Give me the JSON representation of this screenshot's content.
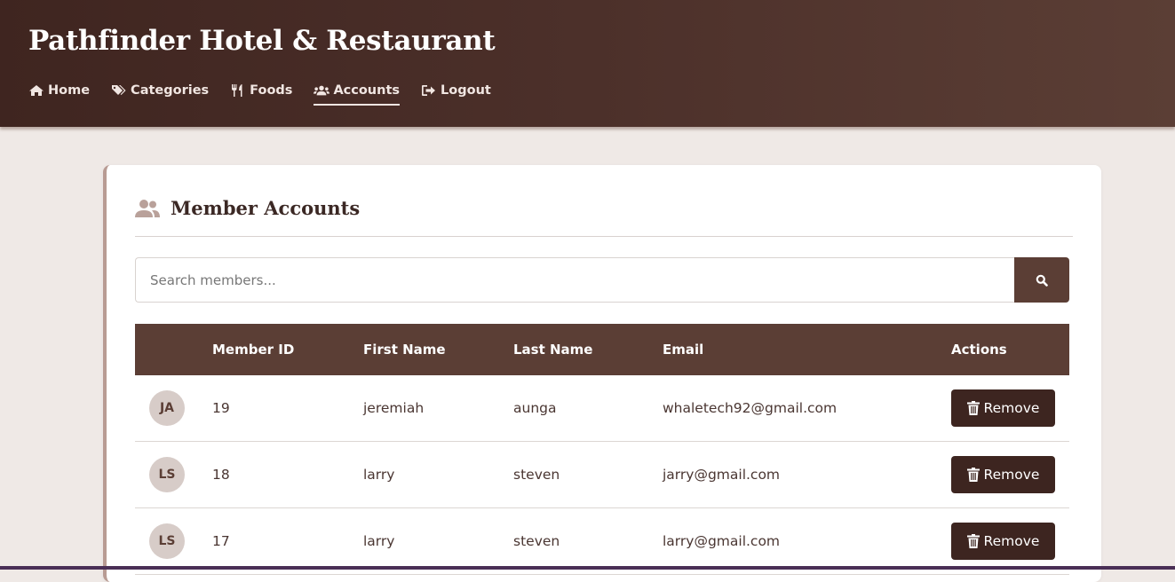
{
  "header": {
    "title": "Pathfinder Hotel & Restaurant",
    "nav": [
      {
        "label": "Home",
        "icon": "home-icon"
      },
      {
        "label": "Categories",
        "icon": "tags-icon"
      },
      {
        "label": "Foods",
        "icon": "utensils-icon"
      },
      {
        "label": "Accounts",
        "icon": "users-icon",
        "active": true
      },
      {
        "label": "Logout",
        "icon": "sign-out-icon"
      }
    ]
  },
  "card": {
    "title": "Member Accounts",
    "icon": "users-icon"
  },
  "search": {
    "placeholder": "Search members...",
    "button_icon": "search-icon"
  },
  "table": {
    "columns": [
      "",
      "Member ID",
      "First Name",
      "Last Name",
      "Email",
      "Actions"
    ],
    "rows": [
      {
        "initials": "JA",
        "id": "19",
        "first": "jeremiah",
        "last": "aunga",
        "email": "whaletech92@gmail.com",
        "action": "Remove"
      },
      {
        "initials": "LS",
        "id": "18",
        "first": "larry",
        "last": "steven",
        "email": "jarry@gmail.com",
        "action": "Remove"
      },
      {
        "initials": "LS",
        "id": "17",
        "first": "larry",
        "last": "steven",
        "email": "larry@gmail.com",
        "action": "Remove"
      }
    ]
  },
  "colors": {
    "header_bg": "#4c302a",
    "table_header": "#5b3e35",
    "button": "#3d2520",
    "avatar_bg": "#d7ccc8",
    "page_bg": "#efe9e6"
  }
}
